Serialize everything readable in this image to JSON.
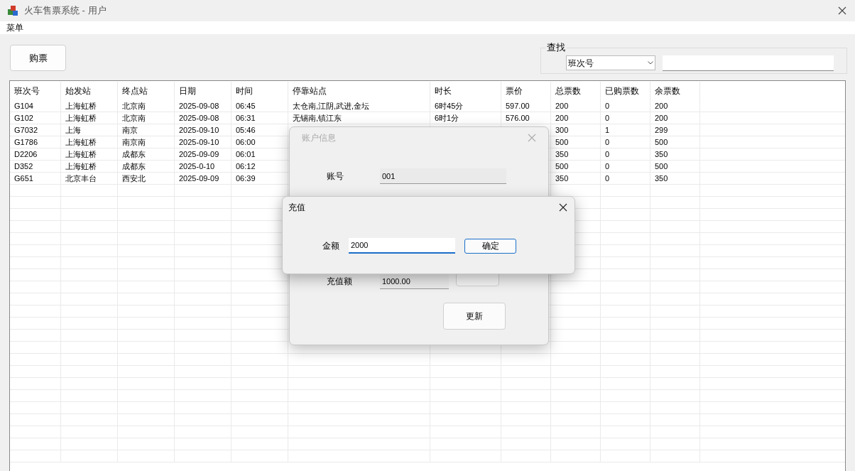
{
  "window": {
    "title": "火车售票系统 - 用户"
  },
  "menu": [
    "菜单"
  ],
  "toolbar": {
    "buy_button": "购票",
    "search": {
      "legend": "查找",
      "field_select": "班次号"
    }
  },
  "table": {
    "columns": [
      "班次号",
      "始发站",
      "终点站",
      "日期",
      "时间",
      "停靠站点",
      "时长",
      "票价",
      "总票数",
      "已购票数",
      "余票数"
    ],
    "rows": [
      [
        "G104",
        "上海虹桥",
        "北京南",
        "2025-09-08",
        "06:45",
        "太仓南,江阴,武进,金坛",
        "6时45分",
        "597.00",
        "200",
        "0",
        "200"
      ],
      [
        "G102",
        "上海虹桥",
        "北京南",
        "2025-09-08",
        "06:31",
        "无锡南,镇江东",
        "6时1分",
        "576.00",
        "200",
        "0",
        "200"
      ],
      [
        "G7032",
        "上海",
        "南京",
        "2025-09-10",
        "05:46",
        null,
        null,
        null,
        "300",
        "1",
        "299"
      ],
      [
        "G1786",
        "上海虹桥",
        "南京南",
        "2025-09-10",
        "06:00",
        null,
        null,
        null,
        "500",
        "0",
        "500"
      ],
      [
        "D2206",
        "上海虹桥",
        "成都东",
        "2025-09-09",
        "06:01",
        null,
        null,
        null,
        "350",
        "0",
        "350"
      ],
      [
        "D352",
        "上海虹桥",
        "成都东",
        "2025-0-10",
        "06:12",
        null,
        null,
        null,
        "500",
        "0",
        "500"
      ],
      [
        "G651",
        "北京丰台",
        "西安北",
        "2025-09-09",
        "06:39",
        null,
        null,
        null,
        "350",
        "0",
        "350"
      ]
    ]
  },
  "account_dialog": {
    "title": "账户信息",
    "fields": [
      {
        "label": "账号",
        "value": "001"
      },
      {
        "label": "充值额",
        "value": "1000.00"
      }
    ],
    "update_button": "更新"
  },
  "recharge_dialog": {
    "title": "充值",
    "amount_label": "金额",
    "amount": "2000",
    "confirm_button": "确定"
  }
}
